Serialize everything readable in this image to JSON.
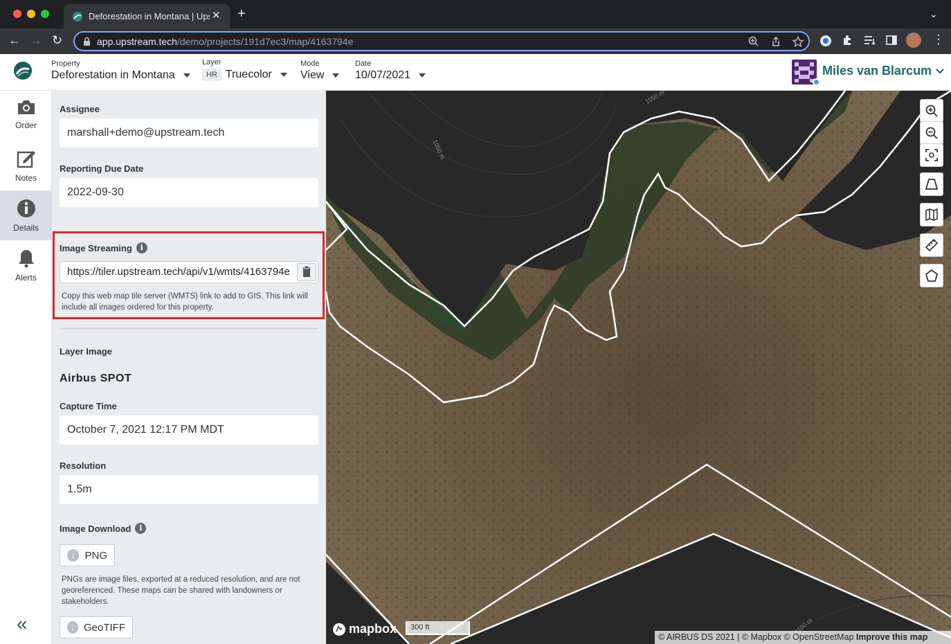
{
  "browser": {
    "tab_title": "Deforestation in Montana | Upstream",
    "url_host": "app.upstream.tech",
    "url_path": "/demo/projects/191d7ec3/map/4163794e"
  },
  "header": {
    "property_label": "Property",
    "property_value": "Deforestation in Montana",
    "layer_label": "Layer",
    "layer_badge": "HR",
    "layer_value": "Truecolor",
    "mode_label": "Mode",
    "mode_value": "View",
    "date_label": "Date",
    "date_value": "10/07/2021",
    "user_name": "Miles van Blarcum"
  },
  "leftnav": {
    "items": [
      {
        "label": "Order",
        "icon": "camera-icon"
      },
      {
        "label": "Notes",
        "icon": "edit-icon"
      },
      {
        "label": "Details",
        "icon": "info-icon"
      },
      {
        "label": "Alerts",
        "icon": "bell-icon"
      }
    ],
    "active": "Details"
  },
  "details": {
    "assignee_label": "Assignee",
    "assignee_value": "marshall+demo@upstream.tech",
    "due_label": "Reporting Due Date",
    "due_value": "2022-09-30",
    "streaming_label": "Image Streaming",
    "streaming_url": "https://tiler.upstream.tech/api/v1/wmts/4163794e",
    "streaming_help": "Copy this web map tile server (WMTS) link to add to GIS. This link will include all images ordered for this property.",
    "layer_image_label": "Layer Image",
    "layer_image_value": "Airbus SPOT",
    "capture_label": "Capture Time",
    "capture_value": "October 7, 2021 12:17 PM MDT",
    "resolution_label": "Resolution",
    "resolution_value": "1.5m",
    "download_label": "Image Download",
    "png_label": "PNG",
    "png_help": "PNGs are image files, exported at a reduced resolution, and are not georeferenced. These maps can be shared with landowners or stakeholders.",
    "geotiff_label": "GeoTIFF"
  },
  "map": {
    "contour_labels": [
      "1050 m",
      "1050 m",
      "1100 m",
      "1100 m"
    ],
    "mapbox_label": "mapbox",
    "scale_label": "300 ft",
    "attribution": "© AIRBUS DS 2021 | © Mapbox © OpenStreetMap",
    "improve_link": "Improve this map"
  },
  "colors": {
    "accent": "#1e6a6a",
    "highlight": "#e32626",
    "panel_bg": "#e9ecef"
  }
}
